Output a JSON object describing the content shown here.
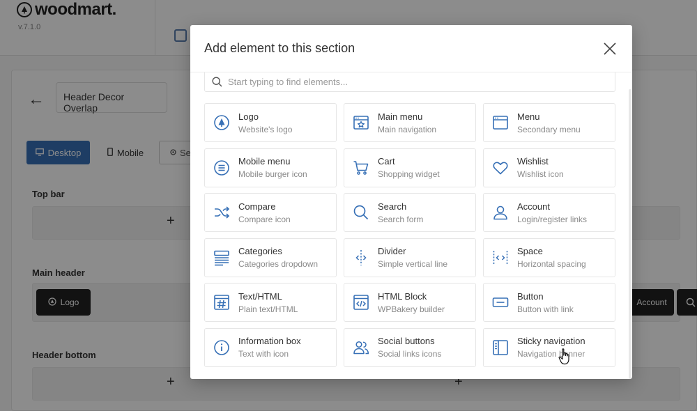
{
  "brand": {
    "name": "woodmart.",
    "version": "v.7.1.0"
  },
  "header_builder": {
    "back_label": "←",
    "header_name": "Header Decor Overlap",
    "view_buttons": {
      "desktop": "Desktop",
      "mobile": "Mobile",
      "settings": "Se"
    },
    "sections": [
      {
        "label": "Top bar"
      },
      {
        "label": "Main header"
      },
      {
        "label": "Header bottom"
      }
    ],
    "add_symbol": "+",
    "chips": {
      "logo": "Logo",
      "account": "Account"
    }
  },
  "modal": {
    "title": "Add element to this section",
    "search_placeholder": "Start typing to find elements...",
    "accent_color": "#3770b6",
    "elements": [
      {
        "title": "Logo",
        "subtitle": "Website's logo",
        "icon": "logo-icon"
      },
      {
        "title": "Main menu",
        "subtitle": "Main navigation",
        "icon": "main-menu-icon"
      },
      {
        "title": "Menu",
        "subtitle": "Secondary menu",
        "icon": "menu-icon"
      },
      {
        "title": "Mobile menu",
        "subtitle": "Mobile burger icon",
        "icon": "mobile-menu-icon"
      },
      {
        "title": "Cart",
        "subtitle": "Shopping widget",
        "icon": "cart-icon"
      },
      {
        "title": "Wishlist",
        "subtitle": "Wishlist icon",
        "icon": "heart-icon"
      },
      {
        "title": "Compare",
        "subtitle": "Compare icon",
        "icon": "shuffle-icon"
      },
      {
        "title": "Search",
        "subtitle": "Search form",
        "icon": "search-icon"
      },
      {
        "title": "Account",
        "subtitle": "Login/register links",
        "icon": "user-icon"
      },
      {
        "title": "Categories",
        "subtitle": "Categories dropdown",
        "icon": "categories-icon"
      },
      {
        "title": "Divider",
        "subtitle": "Simple vertical line",
        "icon": "divider-icon"
      },
      {
        "title": "Space",
        "subtitle": "Horizontal spacing",
        "icon": "space-icon"
      },
      {
        "title": "Text/HTML",
        "subtitle": "Plain text/HTML",
        "icon": "text-html-icon"
      },
      {
        "title": "HTML Block",
        "subtitle": "WPBakery builder",
        "icon": "html-block-icon"
      },
      {
        "title": "Button",
        "subtitle": "Button with link",
        "icon": "button-icon"
      },
      {
        "title": "Information box",
        "subtitle": "Text with icon",
        "icon": "info-icon"
      },
      {
        "title": "Social buttons",
        "subtitle": "Social links icons",
        "icon": "users-icon"
      },
      {
        "title": "Sticky navigation",
        "subtitle": "Navigation banner",
        "icon": "sticky-nav-icon"
      }
    ]
  }
}
